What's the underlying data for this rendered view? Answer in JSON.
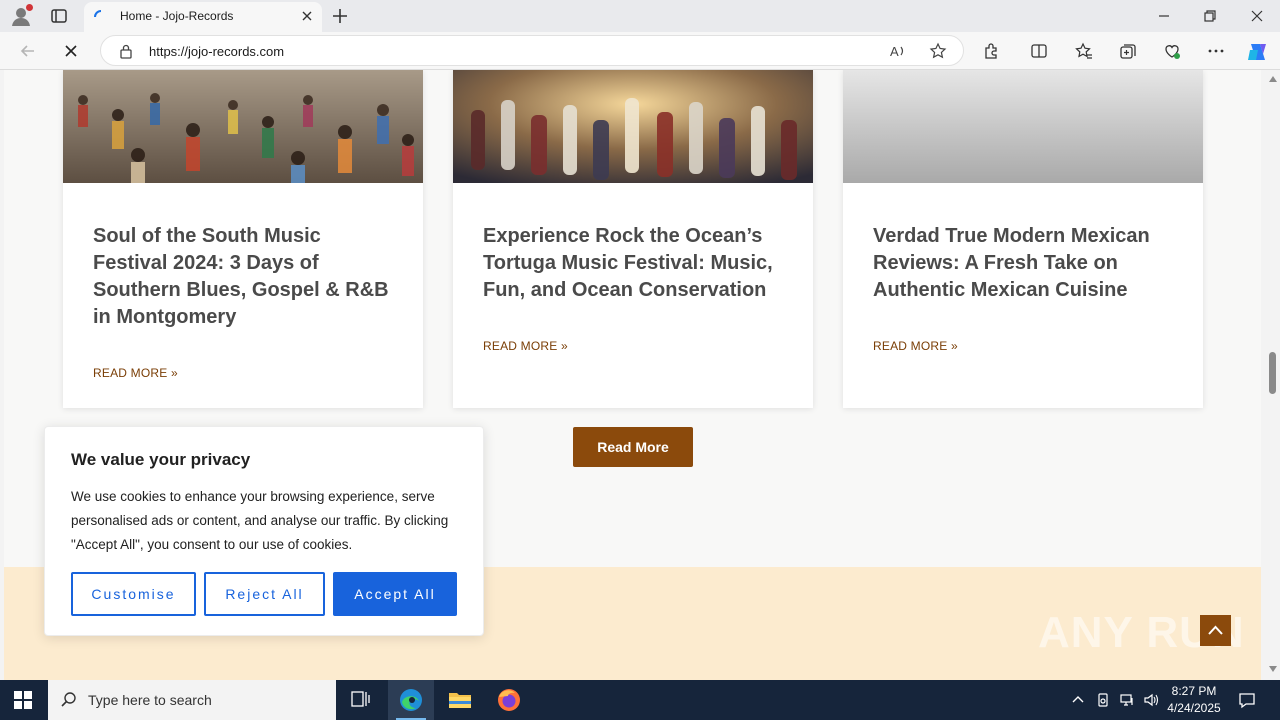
{
  "browser": {
    "tab_title": "Home - Jojo-Records",
    "url": "https://jojo-records.com"
  },
  "posts": [
    {
      "title": "Soul of the South Music Festival 2024: 3 Days of Southern Blues, Gospel & R&B in Montgomery",
      "link": "READ MORE »"
    },
    {
      "title": "Experience Rock the Ocean’s Tortuga Music Festival: Music, Fun, and Ocean Conservation",
      "link": "READ MORE »"
    },
    {
      "title": "Verdad True Modern Mexican Reviews: A Fresh Take on Authentic Mexican Cuisine",
      "link": "READ MORE »"
    }
  ],
  "read_more_button": "Read More",
  "cookie_banner": {
    "title": "We value your privacy",
    "text": "We use cookies to enhance your browsing experience, serve personalised ads or content, and analyse our traffic. By clicking \"Accept All\", you consent to our use of cookies.",
    "customise": "Customise",
    "reject": "Reject All",
    "accept": "Accept All"
  },
  "watermark": "ANY RUN",
  "taskbar": {
    "search_placeholder": "Type here to search",
    "time": "8:27 PM",
    "date": "4/24/2025"
  },
  "colors": {
    "brand_brown": "#8b4a0c",
    "link_brown": "#7a3e06",
    "cookie_blue": "#1863dc",
    "footer_cream": "#fcebcf",
    "taskbar": "#16253b"
  }
}
